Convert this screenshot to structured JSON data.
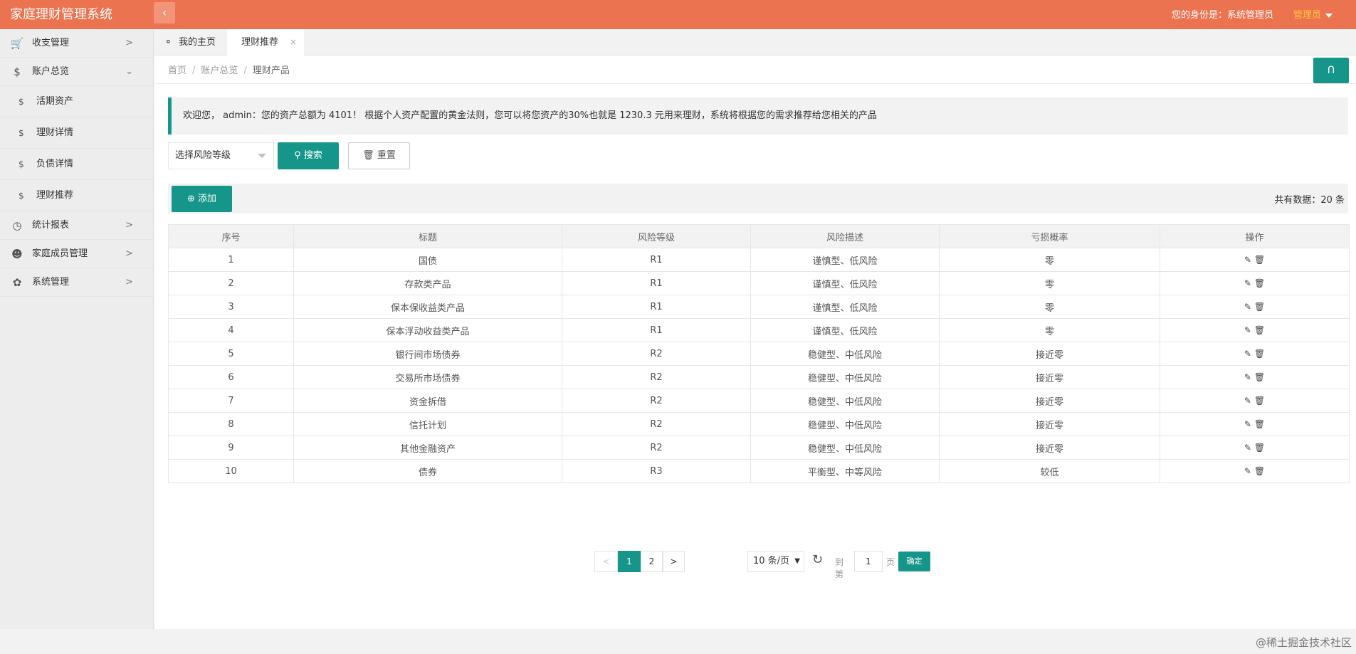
{
  "header": {
    "app_title": "家庭理财管理系统",
    "collapse_icon": "chevron-left-icon",
    "identity_text": "您的身份是：系统管理员",
    "role_label": "管理员",
    "accent_color": "#ec7350"
  },
  "sidebar": {
    "items": [
      {
        "label": "收支管理",
        "icon": "cart-icon"
      },
      {
        "label": "账户总览",
        "icon": "dollar-icon",
        "expanded": true,
        "children": [
          {
            "label": "活期资产",
            "icon": "dollar-icon"
          },
          {
            "label": "理财详情",
            "icon": "dollar-icon"
          },
          {
            "label": "负债详情",
            "icon": "dollar-icon"
          },
          {
            "label": "理财推荐",
            "icon": "dollar-icon"
          }
        ]
      },
      {
        "label": "统计报表",
        "icon": "gauge-icon"
      },
      {
        "label": "家庭成员管理",
        "icon": "user-icon"
      },
      {
        "label": "系统管理",
        "icon": "flower-icon"
      }
    ]
  },
  "tabs": [
    {
      "label": "我的主页",
      "icon": "tag-icon"
    },
    {
      "label": "理财推荐",
      "active": true,
      "close": "×"
    }
  ],
  "breadcrumb": {
    "items": [
      "首页",
      "账户总览",
      "理财产品"
    ],
    "separator": "/"
  },
  "refresh_glyph": "ᑎ",
  "notice": "欢迎您， admin：您的资产总额为 4101！ 根据个人资产配置的黄金法则，您可以将您资产的30%也就是 1230.3 元用来理财，系统将根据您的需求推荐给您相关的产品",
  "filters": {
    "risk_select_text": "选择风险等级",
    "search_label": "搜索",
    "reset_label": "重置"
  },
  "toolbar": {
    "add_label": "添加",
    "total_text": "共有数据：20 条"
  },
  "table": {
    "columns": [
      "序号",
      "标题",
      "风险等级",
      "风险描述",
      "亏损概率",
      "操作"
    ],
    "rows": [
      [
        "1",
        "国债",
        "R1",
        "谨慎型、低风险",
        "零"
      ],
      [
        "2",
        "存款类产品",
        "R1",
        "谨慎型、低风险",
        "零"
      ],
      [
        "3",
        "保本保收益类产品",
        "R1",
        "谨慎型、低风险",
        "零"
      ],
      [
        "4",
        "保本浮动收益类产品",
        "R1",
        "谨慎型、低风险",
        "零"
      ],
      [
        "5",
        "银行间市场债券",
        "R2",
        "稳健型、中低风险",
        "接近零"
      ],
      [
        "6",
        "交易所市场债券",
        "R2",
        "稳健型、中低风险",
        "接近零"
      ],
      [
        "7",
        "资金拆借",
        "R2",
        "稳健型、中低风险",
        "接近零"
      ],
      [
        "8",
        "信托计划",
        "R2",
        "稳健型、中低风险",
        "接近零"
      ],
      [
        "9",
        "其他金融资产",
        "R2",
        "稳健型、中低风险",
        "接近零"
      ],
      [
        "10",
        "债券",
        "R3",
        "平衡型、中等风险",
        "较低"
      ]
    ],
    "edit_icon": "pencil-icon",
    "delete_icon": "trash-icon"
  },
  "pagination": {
    "prev": "<",
    "pages": [
      "1",
      "2"
    ],
    "current": "1",
    "next": ">",
    "page_size": "10 条/页",
    "goto_label": "到第",
    "goto_value": "1",
    "page_unit": "页",
    "confirm_label": "确定"
  },
  "corner_watermark": "@稀土掘金技术社区",
  "brand_color": "#16968a"
}
